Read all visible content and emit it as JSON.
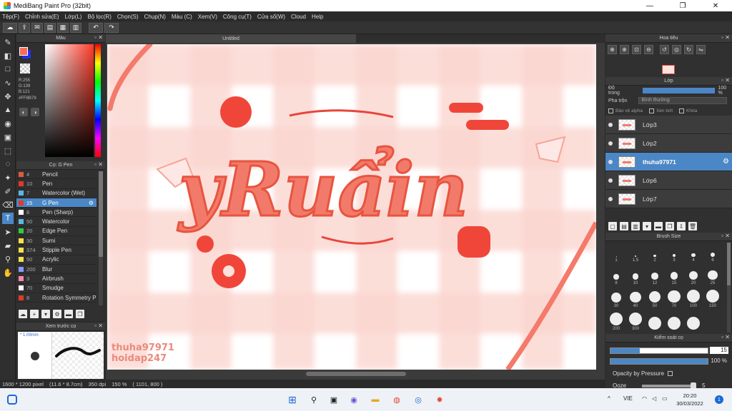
{
  "window": {
    "title": "MediBang Paint Pro (32bit)",
    "minimize": "—",
    "maximize": "❐",
    "close": "✕"
  },
  "menu": [
    "Tệp(F)",
    "Chỉnh sửa(E)",
    "Lớp(L)",
    "Bộ lọc(R)",
    "Chọn(S)",
    "Chụp(N)",
    "Màu (C)",
    "Xem(V)",
    "Công cụ(T)",
    "Cửa sổ(W)",
    "Cloud",
    "Help"
  ],
  "color_panel": {
    "title": "Màu",
    "r": "R:255",
    "g": "G:139",
    "b": "B:121",
    "hex": "#FF8B79",
    "foreground_color": "#ff6b59",
    "background_color": "#2030e8"
  },
  "brush_panel": {
    "title": "Cọ: G Pen",
    "items": [
      {
        "size": "4",
        "name": "Pencil",
        "color": "#e05a3a"
      },
      {
        "size": "10",
        "name": "Pen",
        "color": "#e03a2a"
      },
      {
        "size": "7",
        "name": "Watercolor (Wet)",
        "color": "#59b8e8"
      },
      {
        "size": "15",
        "name": "G Pen",
        "color": "#e03a2a",
        "selected": true
      },
      {
        "size": "8",
        "name": "Pen (Sharp)",
        "color": "#ffffff"
      },
      {
        "size": "50",
        "name": "Watercolor",
        "color": "#59b8e8"
      },
      {
        "size": "20",
        "name": "Edge Pen",
        "color": "#2ecc40"
      },
      {
        "size": "30",
        "name": "Sumi",
        "color": "#f4e04d"
      },
      {
        "size": "374",
        "name": "Stipple Pen",
        "color": "#f4e04d"
      },
      {
        "size": "50",
        "name": "Acrylic",
        "color": "#f4e04d"
      },
      {
        "size": "200",
        "name": "Blur",
        "color": "#8899ff"
      },
      {
        "size": "3",
        "name": "Airbrush",
        "color": "#ff88aa"
      },
      {
        "size": "70",
        "name": "Smudge",
        "color": "#ffffff"
      },
      {
        "size": "8",
        "name": "Rotation Symmetry P",
        "color": "#e03a2a"
      }
    ]
  },
  "preview_panel": {
    "title": "Xem trước cọ",
    "size": "1.09mm"
  },
  "canvas": {
    "tab": "Untitled",
    "watermark_line1": "thuha97971",
    "watermark_line2": "hoidap247"
  },
  "status": {
    "dimensions": "1600 * 1200 pixel",
    "physical": "(11.6 * 8.7cm)",
    "dpi": "350 dpi",
    "zoom": "150 %",
    "coords": "( 1101, 800 )"
  },
  "navigator": {
    "title": "Hoa tiêu"
  },
  "layers_panel": {
    "title": "Lớp",
    "opacity_label": "Độ trong",
    "opacity_value": "100 %",
    "opacity": 1.0,
    "blend_label": "Pha trộn",
    "blend_value": "Bình thường",
    "protect_alpha": "Bảo vệ alpha",
    "clipping": "Xén bớt",
    "lock": "Khóa",
    "layers": [
      {
        "name": "Lớp3"
      },
      {
        "name": "Lớp2"
      },
      {
        "name": "thuha97971",
        "selected": true
      },
      {
        "name": "Lớp6"
      },
      {
        "name": "Lớp7"
      }
    ]
  },
  "brush_size_panel": {
    "title": "Brush Size",
    "sizes": [
      "1",
      "1.5",
      "2",
      "3",
      "4",
      "6",
      "8",
      "10",
      "12",
      "15",
      "20",
      "25",
      "30",
      "40",
      "50",
      "70",
      "100",
      "150",
      "200",
      "300",
      "",
      "",
      ""
    ]
  },
  "brush_control": {
    "title": "Kiểm soát cọ",
    "size_value": "15",
    "size_fraction": 0.3,
    "opacity_value": "100 %",
    "opacity_fraction": 1.0,
    "pressure_label": "Opacity by Pressure",
    "ooze_label": "Ooze",
    "ooze_value": "5",
    "ooze_fraction": 1.0
  },
  "taskbar": {
    "language": "VIE",
    "time": "20:20",
    "date": "30/03/2022",
    "notifications": "1"
  }
}
